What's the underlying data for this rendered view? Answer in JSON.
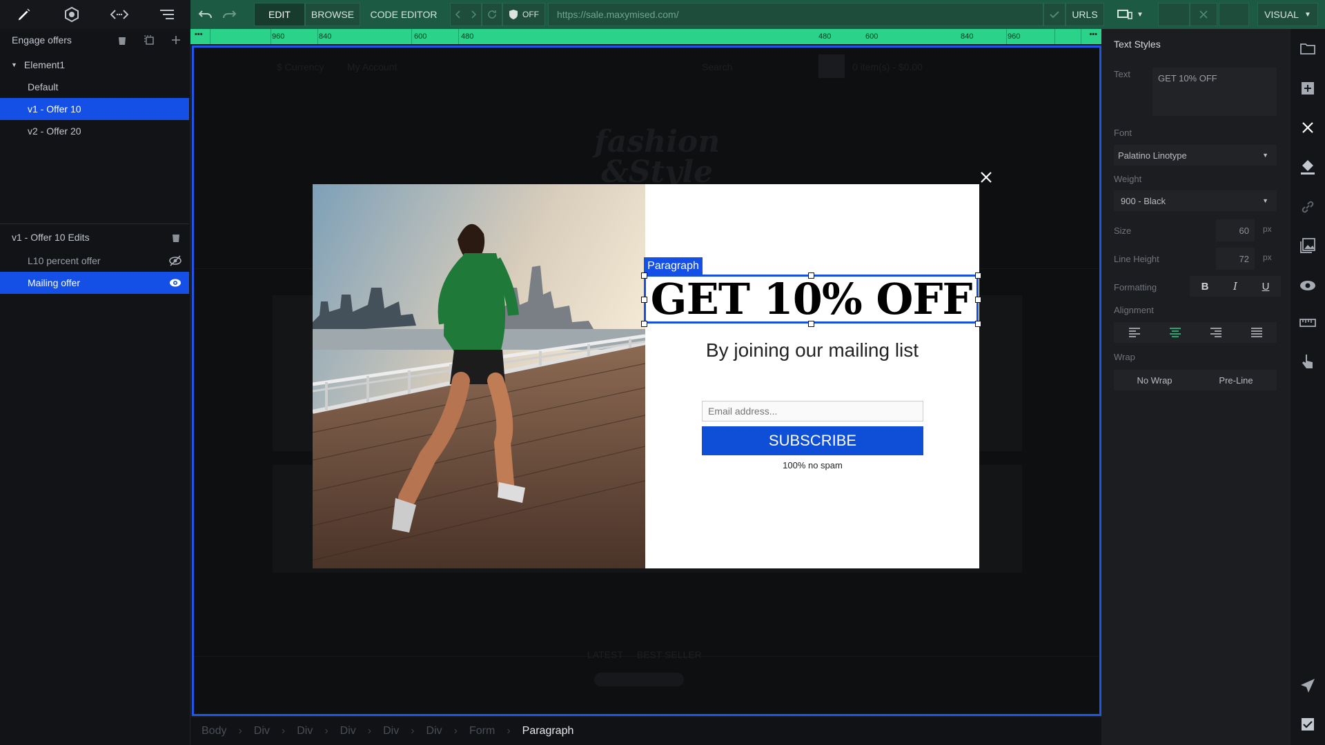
{
  "colors": {
    "accent": "#1450e6",
    "toolbar": "#1d5a43",
    "ruler": "#2ad28a",
    "subscribe": "#0f4fd8"
  },
  "toolbar": {
    "edit": "EDIT",
    "browse": "BROWSE",
    "code_editor": "CODE EDITOR",
    "toggle_state": "OFF",
    "url": "https://sale.maxymised.com/",
    "urls": "URLS",
    "mode": "VISUAL"
  },
  "ruler": {
    "labels": [
      "960",
      "840",
      "600",
      "480",
      "480",
      "600",
      "840",
      "960"
    ]
  },
  "left_panel": {
    "title": "Engage offers",
    "element": "Element1",
    "variants": [
      "Default",
      "v1 - Offer 10",
      "v2 - Offer 20"
    ],
    "edits_title": "v1 - Offer 10 Edits",
    "edits": [
      "L10 percent offer",
      "Mailing offer"
    ]
  },
  "background_page": {
    "currency": "$ Currency",
    "account": "My Account",
    "search": "Search",
    "cart": "0 item(s) - $0.00",
    "logo_line1": "fashion",
    "logo_line2": "&Style",
    "tabs": [
      "LATEST",
      "BEST SELLER"
    ]
  },
  "modal": {
    "selection_tag": "Paragraph",
    "headline": "GET 10% OFF",
    "subheading": "By joining our mailing list",
    "email_placeholder": "Email address...",
    "subscribe": "SUBSCRIBE",
    "no_spam": "100% no spam"
  },
  "breadcrumbs": [
    "Body",
    "Div",
    "Div",
    "Div",
    "Div",
    "Div",
    "Form",
    "Paragraph"
  ],
  "right_panel": {
    "title": "Text Styles",
    "text_label": "Text",
    "text_value": "GET 10% OFF",
    "font_label": "Font",
    "font_value": "Palatino Linotype",
    "weight_label": "Weight",
    "weight_value": "900 - Black",
    "size_label": "Size",
    "size_value": "60",
    "line_height_label": "Line Height",
    "line_height_value": "72",
    "unit": "px",
    "formatting_label": "Formatting",
    "format_bold": "B",
    "format_italic": "I",
    "format_underline": "U",
    "alignment_label": "Alignment",
    "wrap_label": "Wrap",
    "wrap_options": [
      "No Wrap",
      "Pre-Line"
    ]
  },
  "icons": {
    "top": [
      "pencil-icon",
      "settings-icon",
      "code-icon",
      "sort-icon"
    ],
    "rail": [
      "folder-icon",
      "add-icon",
      "close-icon",
      "paint-bucket-icon",
      "link-icon",
      "image-icon",
      "eye-icon",
      "ruler-icon",
      "touch-icon",
      "send-icon",
      "checkbox-icon"
    ]
  }
}
